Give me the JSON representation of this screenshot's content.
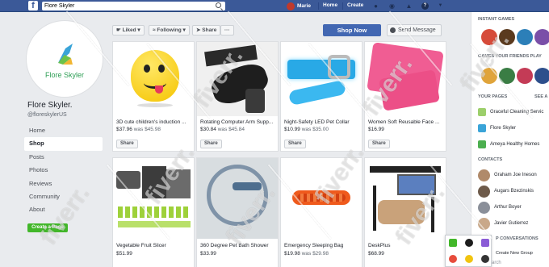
{
  "topbar": {
    "logo": "f",
    "search_value": "Flore Skyler",
    "user_name": "Marie",
    "home": "Home",
    "create": "Create"
  },
  "profile": {
    "brand": "Flore Skyler",
    "name": "Flore Skyler.",
    "handle": "@floreskylerUS"
  },
  "nav": [
    "Home",
    "Shop",
    "Posts",
    "Photos",
    "Reviews",
    "Community",
    "About"
  ],
  "create_page": "Create a Page",
  "actions": {
    "liked": "Liked",
    "following": "Following",
    "share": "Share",
    "more": "···",
    "shop_now": "Shop Now",
    "send_message": "Send Message"
  },
  "products": [
    {
      "title": "3D cute children's induction ...",
      "price": "$37.96",
      "was": "was $45.98"
    },
    {
      "title": "Rotating Computer Arm Supp...",
      "price": "$30.84",
      "was": "was $45.84"
    },
    {
      "title": "Night-Safety LED Pet Collar",
      "price": "$10.99",
      "was": "was $35.00"
    },
    {
      "title": "Women Soft Reusable Face ...",
      "price": "$16.99",
      "was": ""
    },
    {
      "title": "Vegetable Fruit Slicer",
      "price": "$51.99",
      "was": ""
    },
    {
      "title": "360 Degree Pet Bath Shower",
      "price": "$33.99",
      "was": ""
    },
    {
      "title": "Emergency Sleeping Bag",
      "price": "$19.98",
      "was": "was $29.98"
    },
    {
      "title": "DeskPlus",
      "price": "$68.99",
      "was": ""
    }
  ],
  "share_label": "Share",
  "right": {
    "instant_games": "INSTANT GAMES",
    "games_friends": "GAMES YOUR FRIENDS PLAY",
    "your_pages": "YOUR PAGES",
    "see_all": "SEE A",
    "pages": [
      "Graceful Cleaning Servic",
      "Flore Skyler",
      "Ameya Healthy Homes"
    ],
    "contacts_head": "CONTACTS",
    "contacts": [
      "Graham Joe Ineson",
      "Augars Bzezinskis",
      "Arthur Boyer",
      "Javier Gutierrez"
    ],
    "conversations": "P CONVERSATIONS",
    "create_group": "Create New Group",
    "search": "arch"
  },
  "watermark": "fiverr."
}
